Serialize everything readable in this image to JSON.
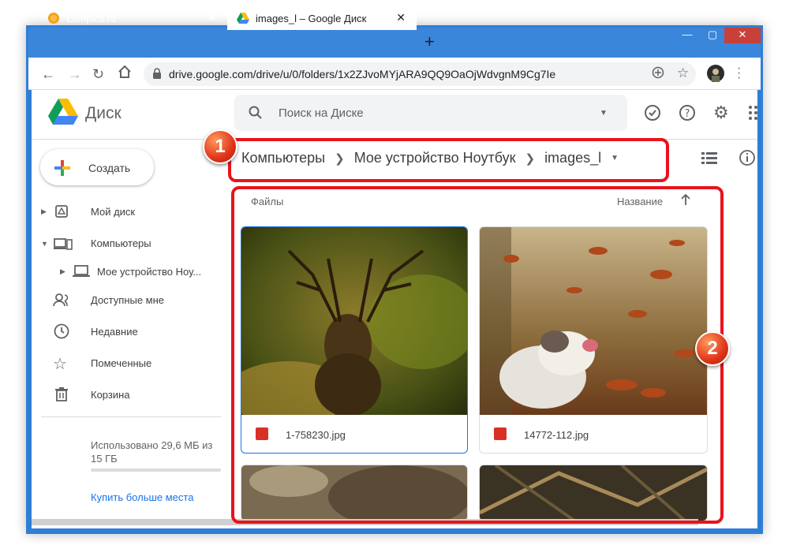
{
  "browser": {
    "tabs": [
      {
        "title": "Lumpics.ru"
      },
      {
        "title": "images_l – Google Диск"
      }
    ],
    "url": "drive.google.com/drive/u/0/folders/1x2ZJvoMYjARA9QQ9OaOjWdvgnM9Cg7Ie"
  },
  "drive": {
    "app_name": "Диск",
    "search_placeholder": "Поиск на Диске",
    "create_label": "Создать",
    "sidebar": {
      "items": [
        {
          "label": "Мой диск"
        },
        {
          "label": "Компьютеры"
        },
        {
          "label": "Мое устройство Ноу..."
        },
        {
          "label": "Доступные мне"
        },
        {
          "label": "Недавние"
        },
        {
          "label": "Помеченные"
        },
        {
          "label": "Корзина"
        }
      ],
      "storage": "Использовано 29,6 МБ из 15 ГБ",
      "buy_more": "Купить больше места"
    },
    "breadcrumb": [
      "Компьютеры",
      "Мое устройство Ноутбук",
      "images_l"
    ],
    "files_label": "Файлы",
    "sort_label": "Название",
    "files": [
      {
        "name": "1-758230.jpg"
      },
      {
        "name": "14772-112.jpg"
      }
    ]
  },
  "annotations": [
    "1",
    "2"
  ],
  "colors": {
    "accent": "#1a73e8",
    "annotation_red": "#e8141b",
    "window_frame": "#2f7ed6"
  }
}
